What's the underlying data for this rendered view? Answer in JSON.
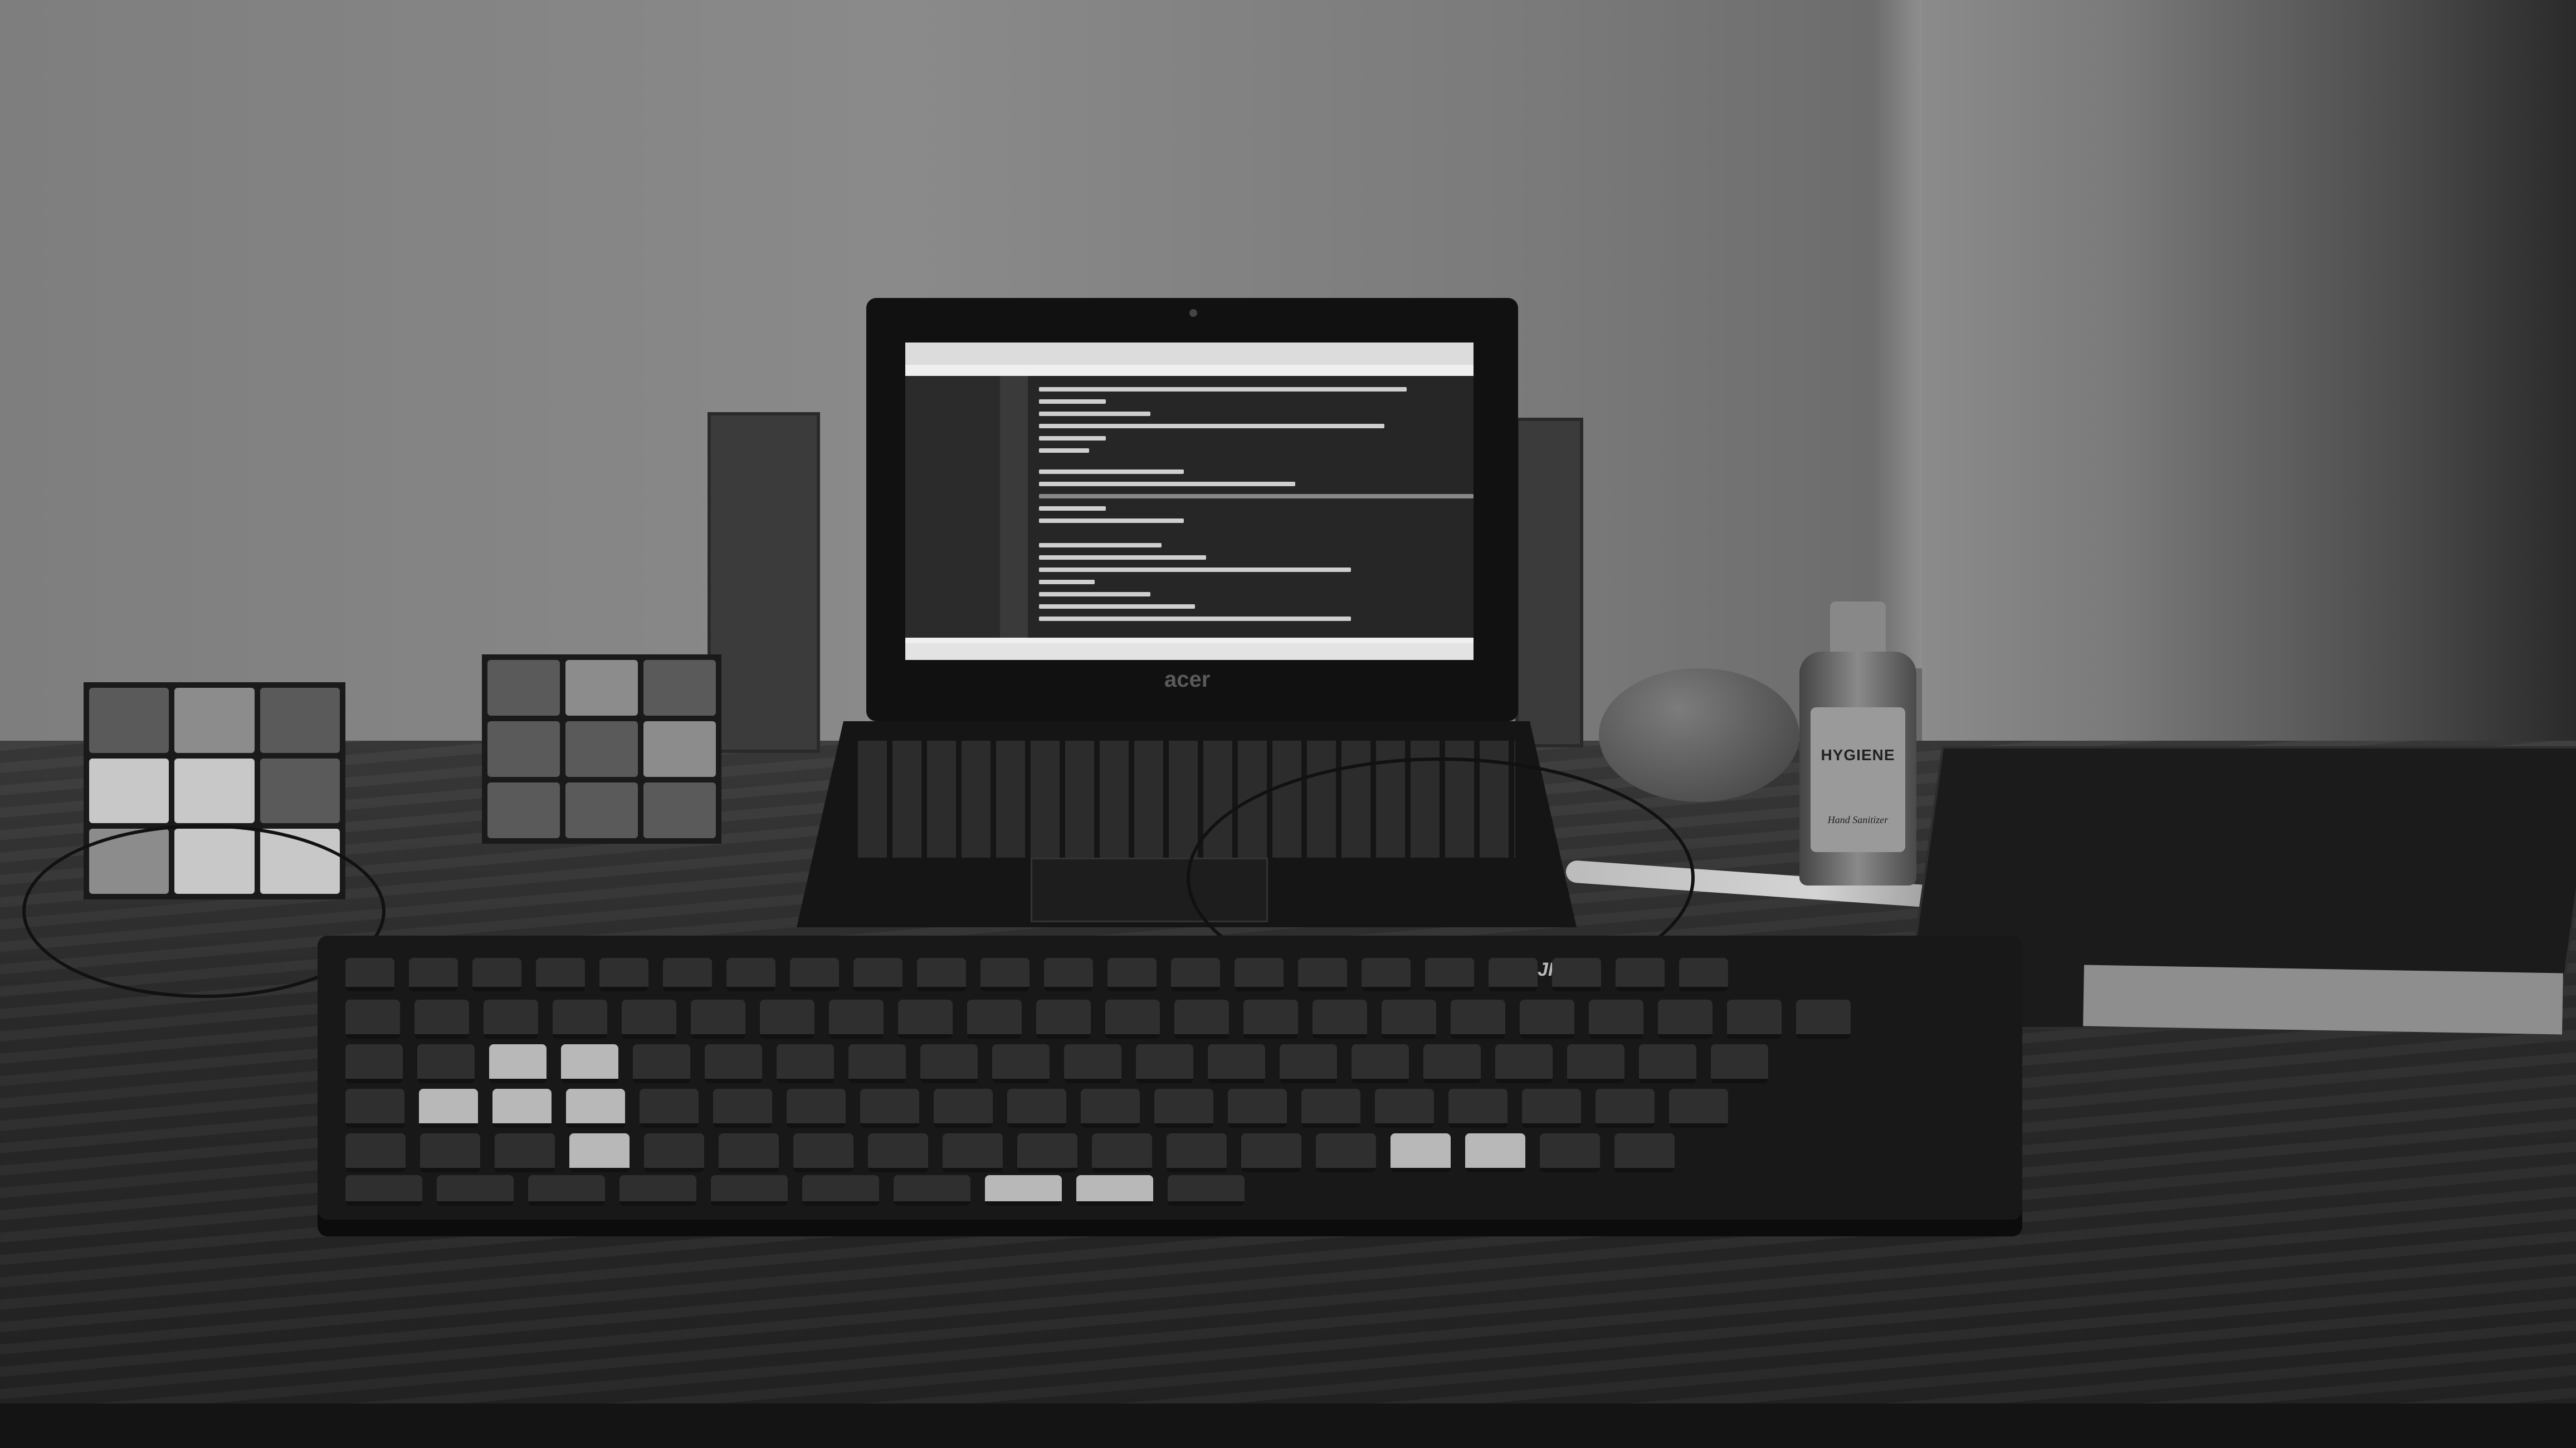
{
  "scene": {
    "laptop": {
      "brand": "acer"
    },
    "bottle": {
      "label_title": "HYGIENE",
      "label_sub": "Hand Sanitizer"
    },
    "keyboard": {
      "logo": "JR"
    }
  },
  "colors": {
    "wall": "#858585",
    "desk": "#2b2b2b",
    "screen": "#262626"
  }
}
